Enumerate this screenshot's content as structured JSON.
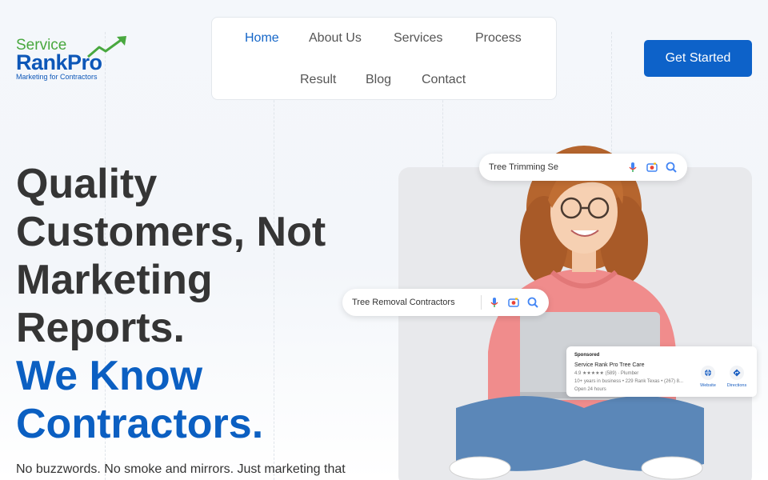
{
  "brand": {
    "top": "Service",
    "main": "RankPro",
    "tagline": "Marketing for Contractors",
    "colors": {
      "green": "#49a83f",
      "blue": "#0d57b8"
    }
  },
  "nav": {
    "items": [
      {
        "label": "Home",
        "active": true
      },
      {
        "label": "About Us",
        "active": false
      },
      {
        "label": "Services",
        "active": false
      },
      {
        "label": "Process",
        "active": false
      },
      {
        "label": "Result",
        "active": false
      },
      {
        "label": "Blog",
        "active": false
      },
      {
        "label": "Contact",
        "active": false
      }
    ],
    "active_color": "#1566c8"
  },
  "cta": {
    "label": "Get Started",
    "color": "#0d62c9"
  },
  "hero": {
    "lines": [
      "Quality",
      "Customers, Not",
      "Marketing",
      "Reports."
    ],
    "accent_lines": [
      "We Know",
      "Contractors."
    ],
    "accent_color": "#0b5fc2",
    "subtext": "No buzzwords. No smoke and mirrors. Just marketing that"
  },
  "search_pills": {
    "top": {
      "query": "Tree Trimming Se"
    },
    "middle": {
      "query": "Tree Removal Contractors"
    }
  },
  "ad": {
    "sponsored": "Sponsored",
    "name": "Service Rank Pro Tree Care",
    "rating": "4.9 ★★★★★ (589) · Plumber",
    "details": "10+ years in business  •  229 Rank Texas  •  (267) 8...",
    "hours": "Open 24 hours",
    "website": "Website",
    "directions": "Directions"
  }
}
